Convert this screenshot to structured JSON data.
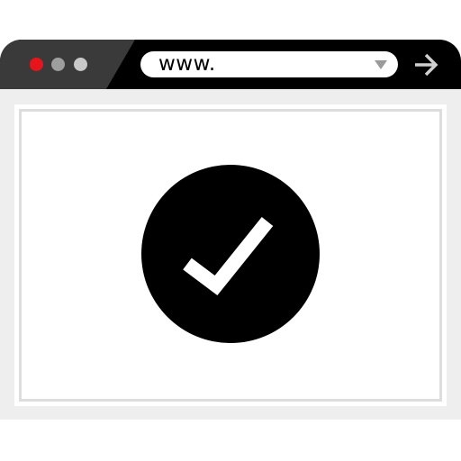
{
  "window": {
    "controls": [
      {
        "name": "close",
        "color": "#e8141b"
      },
      {
        "name": "minimize",
        "color": "#9e9e9e"
      },
      {
        "name": "maximize",
        "color": "#c8c8c8"
      }
    ]
  },
  "address_bar": {
    "value": "www.",
    "dropdown_icon": "triangle-down-icon",
    "go_icon": "arrow-right-icon"
  },
  "main": {
    "icon": "check-circle-icon"
  },
  "colors": {
    "titlebar": "#000000",
    "tab": "#3a3a3a",
    "content_bg": "#eeeeee",
    "page_bg": "#ffffff",
    "page_border": "#dddddd",
    "icon": "#000000"
  }
}
